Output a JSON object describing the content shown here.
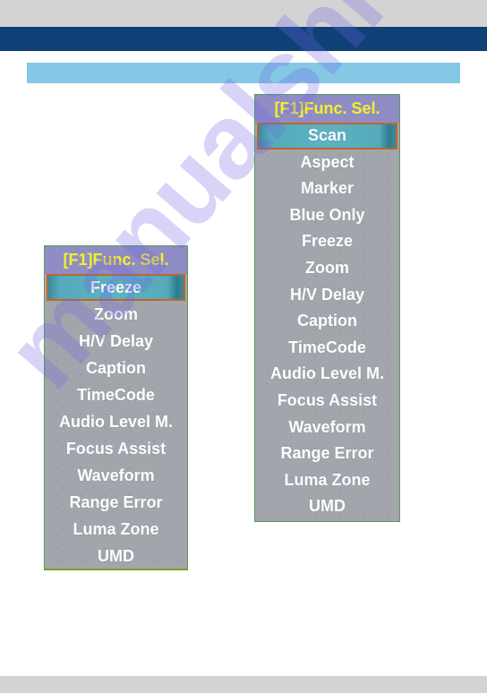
{
  "page": {
    "colors": {
      "top_band": "#d3d3d3",
      "navy_band": "#0f4176",
      "section_bar": "#85c8e6",
      "menu_bg": "#a2a6ac",
      "menu_header_bg": "#8f8dc4",
      "menu_header_text": "#f4f02a",
      "selected_border": "#c0652a",
      "selected_bg": "#5db2c2"
    }
  },
  "menus": {
    "left": {
      "header": "[F1]Func. Sel.",
      "selected": "Freeze",
      "items": [
        "Freeze",
        "Zoom",
        "H/V Delay",
        "Caption",
        "TimeCode",
        "Audio Level M.",
        "Focus Assist",
        "Waveform",
        "Range Error",
        "Luma Zone",
        "UMD"
      ]
    },
    "right": {
      "header": "[F1]Func. Sel.",
      "selected": "Scan",
      "items": [
        "Scan",
        "Aspect",
        "Marker",
        "Blue Only",
        "Freeze",
        "Zoom",
        "H/V Delay",
        "Caption",
        "TimeCode",
        "Audio Level M.",
        "Focus Assist",
        "Waveform",
        "Range Error",
        "Luma Zone",
        "UMD"
      ]
    }
  },
  "watermark": "manualshive.com"
}
